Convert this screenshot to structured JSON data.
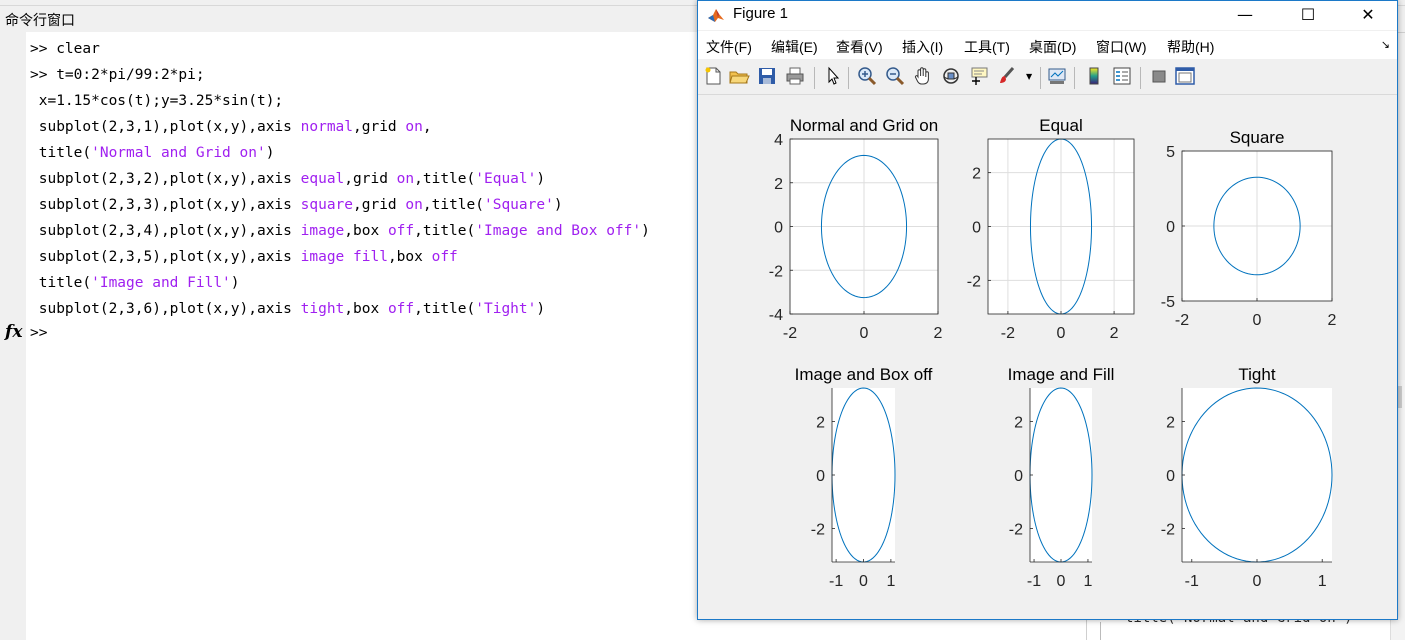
{
  "command_window": {
    "title": "命令行窗口",
    "prompt": ">>",
    "fx": "fx",
    "lines": [
      [
        {
          "t": ">> clear"
        }
      ],
      [
        {
          "t": ">> t=0:2*pi/99:2*pi;"
        }
      ],
      [
        {
          "t": " x=1.15*cos(t);y=3.25*sin(t);"
        }
      ],
      [
        {
          "t": " subplot(2,3,1),plot(x,y),axis "
        },
        {
          "t": "normal",
          "k": 1
        },
        {
          "t": ",grid "
        },
        {
          "t": "on",
          "k": 1
        },
        {
          "t": ","
        }
      ],
      [
        {
          "t": " title("
        },
        {
          "t": "'Normal and Grid on'",
          "k": 1
        },
        {
          "t": ")"
        }
      ],
      [
        {
          "t": " subplot(2,3,2),plot(x,y),axis "
        },
        {
          "t": "equal",
          "k": 1
        },
        {
          "t": ",grid "
        },
        {
          "t": "on",
          "k": 1
        },
        {
          "t": ",title("
        },
        {
          "t": "'Equal'",
          "k": 1
        },
        {
          "t": ")"
        }
      ],
      [
        {
          "t": " subplot(2,3,3),plot(x,y),axis "
        },
        {
          "t": "square",
          "k": 1
        },
        {
          "t": ",grid "
        },
        {
          "t": "on",
          "k": 1
        },
        {
          "t": ",title("
        },
        {
          "t": "'Square'",
          "k": 1
        },
        {
          "t": ")"
        }
      ],
      [
        {
          "t": " subplot(2,3,4),plot(x,y),axis "
        },
        {
          "t": "image",
          "k": 1
        },
        {
          "t": ",box "
        },
        {
          "t": "off",
          "k": 1
        },
        {
          "t": ",title("
        },
        {
          "t": "'Image and Box off'",
          "k": 1
        },
        {
          "t": ")"
        }
      ],
      [
        {
          "t": " subplot(2,3,5),plot(x,y),axis "
        },
        {
          "t": "image fill",
          "k": 1
        },
        {
          "t": ",box "
        },
        {
          "t": "off",
          "k": 1
        }
      ],
      [
        {
          "t": " title("
        },
        {
          "t": "'Image and Fill'",
          "k": 1
        },
        {
          "t": ")"
        }
      ],
      [
        {
          "t": " subplot(2,3,6),plot(x,y),axis "
        },
        {
          "t": "tight",
          "k": 1
        },
        {
          "t": ",box "
        },
        {
          "t": "off",
          "k": 1
        },
        {
          "t": ",title("
        },
        {
          "t": "'Tight'",
          "k": 1
        },
        {
          "t": ")"
        }
      ]
    ],
    "background_fragment": "title('Normal and Grid on')"
  },
  "figure": {
    "title": "Figure 1",
    "window_buttons": [
      "—",
      "☐",
      "✕"
    ],
    "menus": [
      "文件(F)",
      "编辑(E)",
      "查看(V)",
      "插入(I)",
      "工具(T)",
      "桌面(D)",
      "窗口(W)",
      "帮助(H)"
    ],
    "toolbar_icons": [
      "new-figure-icon",
      "open-file-icon",
      "save-icon",
      "print-icon",
      "select-arrow-icon",
      "zoom-in-icon",
      "zoom-out-icon",
      "pan-hand-icon",
      "rotate-3d-icon",
      "data-cursor-icon",
      "brush-icon",
      "link-plot-icon",
      "colorbar-icon",
      "legend-icon",
      "hide-plot-tools-icon",
      "show-plot-tools-icon"
    ],
    "line_color": "#0072bd"
  },
  "chart_data": [
    {
      "type": "line",
      "title": "Normal and Grid on",
      "x_equation": "x=1.15*cos(t)",
      "y_equation": "y=3.25*sin(t)",
      "xlim": [
        -2,
        2
      ],
      "ylim": [
        -4,
        4
      ],
      "xticks": [
        "-2",
        "0",
        "2"
      ],
      "yticks": [
        "4",
        "2",
        "0",
        "-2",
        "-4"
      ],
      "grid": true,
      "box": true
    },
    {
      "type": "line",
      "title": "Equal",
      "xlim": [
        -2.75,
        2.75
      ],
      "ylim": [
        -3.25,
        3.25
      ],
      "xticks": [
        "-2",
        "0",
        "2"
      ],
      "yticks": [
        "2",
        "0",
        "-2"
      ],
      "grid": true,
      "box": true
    },
    {
      "type": "line",
      "title": "Square",
      "xlim": [
        -2,
        2
      ],
      "ylim": [
        -5,
        5
      ],
      "xticks": [
        "-2",
        "0",
        "2"
      ],
      "yticks": [
        "5",
        "0",
        "-5"
      ],
      "grid": true,
      "box": true
    },
    {
      "type": "line",
      "title": "Image and Box off",
      "xlim": [
        -1.15,
        1.15
      ],
      "ylim": [
        -3.25,
        3.25
      ],
      "xticks": [
        "-1",
        "0",
        "1"
      ],
      "yticks": [
        "2",
        "0",
        "-2"
      ],
      "grid": false,
      "box": false
    },
    {
      "type": "line",
      "title": "Image and Fill",
      "xlim": [
        -1.15,
        1.15
      ],
      "ylim": [
        -3.25,
        3.25
      ],
      "xticks": [
        "-1",
        "0",
        "1"
      ],
      "yticks": [
        "2",
        "0",
        "-2"
      ],
      "grid": false,
      "box": false
    },
    {
      "type": "line",
      "title": "Tight",
      "xlim": [
        -1.15,
        1.15
      ],
      "ylim": [
        -3.25,
        3.25
      ],
      "xticks": [
        "-1",
        "0",
        "1"
      ],
      "yticks": [
        "2",
        "0",
        "-2"
      ],
      "grid": false,
      "box": false
    }
  ]
}
